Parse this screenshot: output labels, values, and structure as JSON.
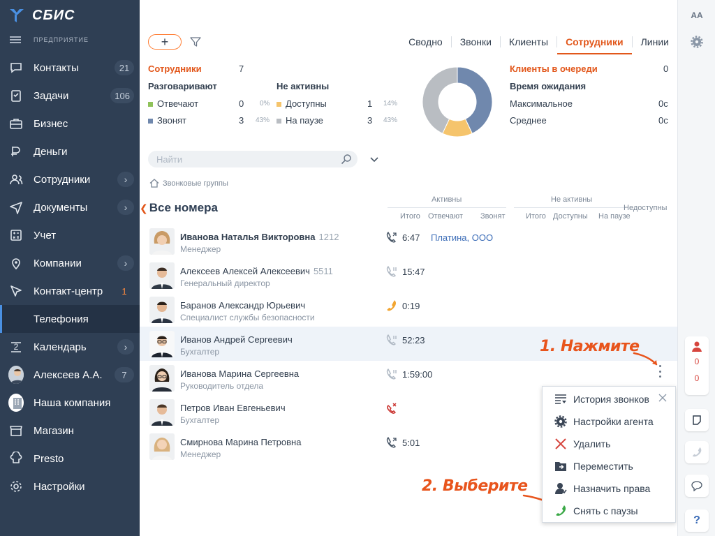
{
  "app": {
    "logo_text": "СБИС",
    "org_label": "ПРЕДПРИЯТИЕ"
  },
  "sidebar": {
    "items": [
      {
        "label": "Контакты",
        "icon": "chat-icon",
        "count": "21"
      },
      {
        "label": "Задачи",
        "icon": "tasks-icon",
        "count": "106"
      },
      {
        "label": "Бизнес",
        "icon": "briefcase-icon"
      },
      {
        "label": "Деньги",
        "icon": "money-icon"
      },
      {
        "label": "Сотрудники",
        "icon": "people-icon",
        "arrow": true
      },
      {
        "label": "Документы",
        "icon": "send-icon",
        "arrow": true
      },
      {
        "label": "Учет",
        "icon": "calculator-icon"
      },
      {
        "label": "Компании",
        "icon": "location-icon",
        "arrow": true
      },
      {
        "label": "Контакт-центр",
        "icon": "contact-center-icon",
        "count": "1"
      },
      {
        "label": "Телефония",
        "sub": true
      },
      {
        "label": "Календарь",
        "icon": "calendar-icon",
        "calendar_day": "2",
        "arrow": true
      },
      {
        "label": "Алексеев А.А.",
        "icon": "user-avatar",
        "count": "7"
      },
      {
        "label": "Наша компания",
        "icon": "company-avatar"
      },
      {
        "label": "Магазин",
        "icon": "shop-icon"
      },
      {
        "label": "Presto",
        "icon": "chef-icon"
      },
      {
        "label": "Настройки",
        "icon": "gear-icon"
      }
    ]
  },
  "toolbar": {
    "add_label": "+"
  },
  "tabs": [
    "Сводно",
    "Звонки",
    "Клиенты",
    "Сотрудники",
    "Линии"
  ],
  "active_tab": "Сотрудники",
  "stats": {
    "employees_label": "Сотрудники",
    "employees_value": "7",
    "talking_label": "Разговаривают",
    "inactive_label": "Не активны",
    "answering": {
      "label": "Отвечают",
      "value": "0",
      "pct": "0%"
    },
    "ringing": {
      "label": "Звонят",
      "value": "3",
      "pct": "43%"
    },
    "available": {
      "label": "Доступны",
      "value": "1",
      "pct": "14%"
    },
    "paused": {
      "label": "На паузе",
      "value": "3",
      "pct": "43%"
    },
    "queue_label": "Клиенты в очереди",
    "queue_value": "0",
    "wait_label": "Время ожидания",
    "max_label": "Максимальное",
    "max_value": "0с",
    "avg_label": "Среднее",
    "avg_value": "0с"
  },
  "donut": {
    "segments": [
      {
        "name": "Звонят",
        "fraction": 0.43,
        "color": "#7088ad"
      },
      {
        "name": "Доступны",
        "fraction": 0.14,
        "color": "#f5c46c"
      },
      {
        "name": "На паузе",
        "fraction": 0.43,
        "color": "#b9bdc2"
      }
    ]
  },
  "search": {
    "placeholder": "Найти"
  },
  "breadcrumb": "Звонковые группы",
  "group_title": "Все номера",
  "columns": {
    "active": "Активны",
    "inactive": "Не активны",
    "unavailable": "Недоступны",
    "total": "Итого",
    "answering": "Отвечают",
    "ringing": "Звонят",
    "total2": "Итого",
    "available": "Доступны",
    "paused": "На паузе"
  },
  "employees": [
    {
      "name": "Иванова Наталья Викторовна",
      "ext": "1212",
      "position": "Менеджер",
      "bold": true,
      "phone": "active",
      "time": "6:47",
      "client": "Платина, ООО"
    },
    {
      "name": "Алексеев Алексей Алексеевич",
      "ext": "5511",
      "position": "Генеральный директор",
      "phone": "paused",
      "time": "15:47"
    },
    {
      "name": "Баранов Александр Юрьевич",
      "ext": "",
      "position": "Специалист службы безопасности",
      "phone": "available",
      "time": "0:19"
    },
    {
      "name": "Иванов Андрей Сергеевич",
      "ext": "",
      "position": "Бухгалтер",
      "phone": "paused",
      "time": "52:23"
    },
    {
      "name": "Иванова Марина Сергеевна",
      "ext": "",
      "position": "Руководитель отдела",
      "phone": "paused",
      "time": "1:59:00"
    },
    {
      "name": "Петров Иван Евгеньевич",
      "ext": "",
      "position": "Бухгалтер",
      "phone": "unavailable",
      "time": ""
    },
    {
      "name": "Смирнова Марина Петровна",
      "ext": "",
      "position": "Менеджер",
      "phone": "active",
      "time": "5:01"
    }
  ],
  "annotations": {
    "step1": "1. Нажмите",
    "step2": "2. Выберите"
  },
  "context_menu": {
    "items": [
      {
        "label": "История звонков",
        "icon": "history-icon"
      },
      {
        "label": "Настройки агента",
        "icon": "gear-icon"
      },
      {
        "label": "Удалить",
        "icon": "delete-icon"
      },
      {
        "label": "Переместить",
        "icon": "move-folder-icon"
      },
      {
        "label": "Назначить права",
        "icon": "rights-icon"
      },
      {
        "label": "Снять с паузы",
        "icon": "phone-icon"
      }
    ]
  },
  "rail": {
    "font_label": "AA",
    "count1": "0",
    "count2": "0",
    "help": "?"
  },
  "colors": {
    "accent": "#e2571b",
    "sidebar": "#2f3f54",
    "link": "#3b6cb7",
    "annotation": "#e8541c"
  }
}
